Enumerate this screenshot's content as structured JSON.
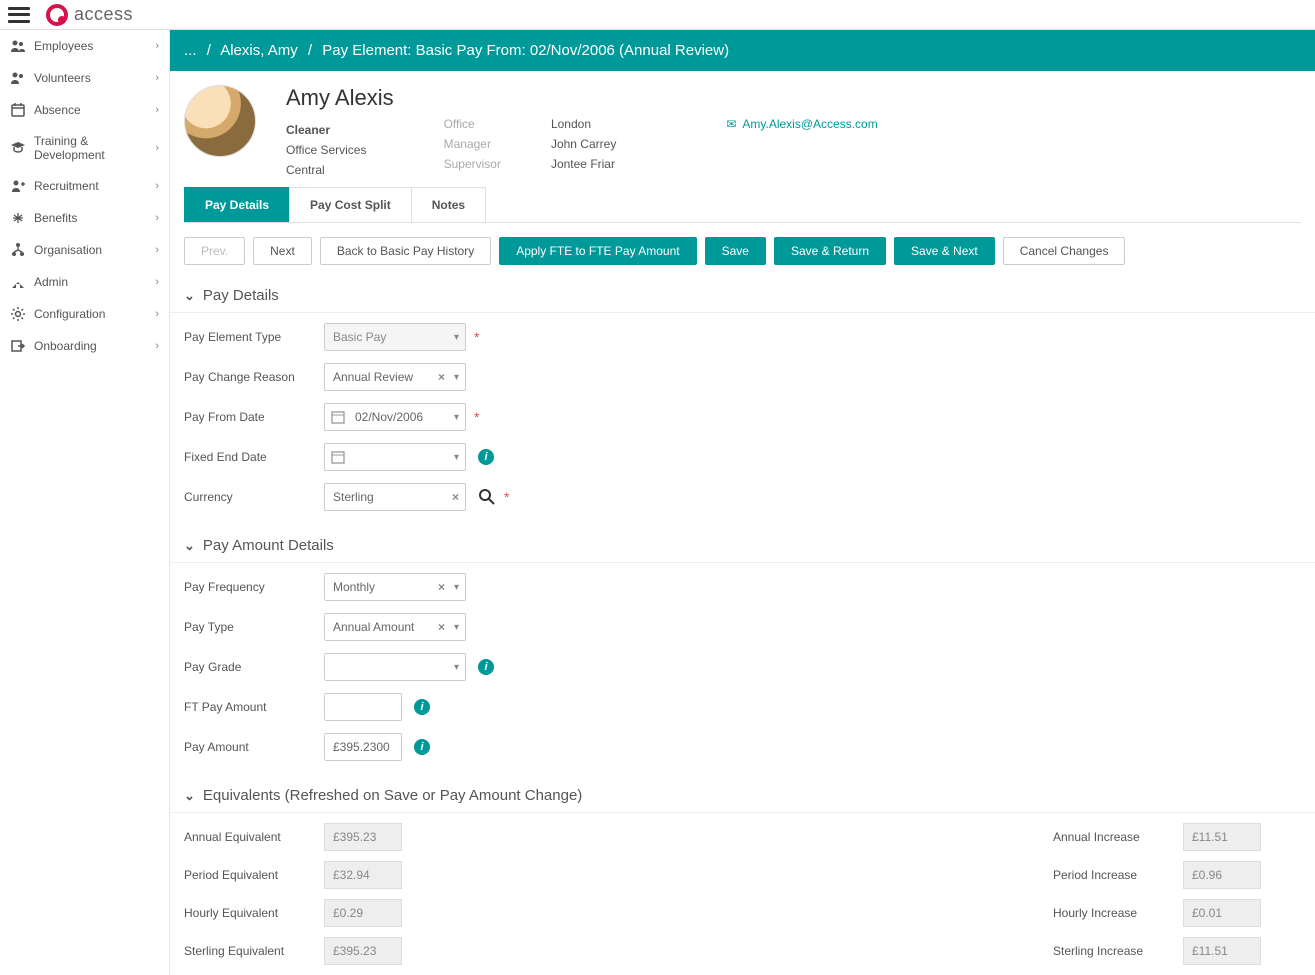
{
  "brand": "access",
  "sidebar": {
    "items": [
      {
        "label": "Employees",
        "icon": "employees-icon"
      },
      {
        "label": "Volunteers",
        "icon": "volunteers-icon"
      },
      {
        "label": "Absence",
        "icon": "absence-icon"
      },
      {
        "label": "Training & Development",
        "icon": "training-icon"
      },
      {
        "label": "Recruitment",
        "icon": "recruitment-icon"
      },
      {
        "label": "Benefits",
        "icon": "benefits-icon"
      },
      {
        "label": "Organisation",
        "icon": "organisation-icon"
      },
      {
        "label": "Admin",
        "icon": "admin-icon"
      },
      {
        "label": "Configuration",
        "icon": "configuration-icon"
      },
      {
        "label": "Onboarding",
        "icon": "onboarding-icon"
      }
    ]
  },
  "breadcrumb": {
    "ellipsis": "...",
    "person": "Alexis, Amy",
    "page": "Pay Element: Basic Pay From: 02/Nov/2006 (Annual Review)"
  },
  "profile": {
    "name": "Amy Alexis",
    "role": "Cleaner",
    "dept": "Office Services",
    "region": "Central",
    "office_lbl": "Office",
    "office": "London",
    "manager_lbl": "Manager",
    "manager": "John Carrey",
    "supervisor_lbl": "Supervisor",
    "supervisor": "Jontee Friar",
    "email": "Amy.Alexis@Access.com"
  },
  "tabs": {
    "pay_details": "Pay Details",
    "pay_cost_split": "Pay Cost Split",
    "notes": "Notes"
  },
  "actions": {
    "prev": "Prev.",
    "next": "Next",
    "back": "Back to Basic Pay History",
    "apply_fte": "Apply FTE to FTE Pay Amount",
    "save": "Save",
    "save_return": "Save & Return",
    "save_next": "Save & Next",
    "cancel": "Cancel Changes"
  },
  "sections": {
    "pay_details": "Pay Details",
    "pay_amount_details": "Pay Amount Details",
    "equivalents": "Equivalents (Refreshed on Save or Pay Amount Change)"
  },
  "form": {
    "pay_element_type_lbl": "Pay Element Type",
    "pay_element_type": "Basic Pay",
    "pay_change_reason_lbl": "Pay Change Reason",
    "pay_change_reason": "Annual Review",
    "pay_from_date_lbl": "Pay From Date",
    "pay_from_date": "02/Nov/2006",
    "fixed_end_date_lbl": "Fixed End Date",
    "fixed_end_date": "",
    "currency_lbl": "Currency",
    "currency": "Sterling",
    "pay_frequency_lbl": "Pay Frequency",
    "pay_frequency": "Monthly",
    "pay_type_lbl": "Pay Type",
    "pay_type": "Annual Amount",
    "pay_grade_lbl": "Pay Grade",
    "pay_grade": "",
    "ft_pay_amount_lbl": "FT Pay Amount",
    "ft_pay_amount": "",
    "pay_amount_lbl": "Pay Amount",
    "pay_amount": "£395.2300"
  },
  "equiv": {
    "annual_eq_lbl": "Annual Equivalent",
    "annual_eq": "£395.23",
    "period_eq_lbl": "Period Equivalent",
    "period_eq": "£32.94",
    "hourly_eq_lbl": "Hourly Equivalent",
    "hourly_eq": "£0.29",
    "sterling_eq_lbl": "Sterling Equivalent",
    "sterling_eq": "£395.23",
    "annual_inc_lbl": "Annual Increase",
    "annual_inc": "£11.51",
    "period_inc_lbl": "Period Increase",
    "period_inc": "£0.96",
    "hourly_inc_lbl": "Hourly Increase",
    "hourly_inc": "£0.01",
    "sterling_inc_lbl": "Sterling Increase",
    "sterling_inc": "£11.51"
  }
}
